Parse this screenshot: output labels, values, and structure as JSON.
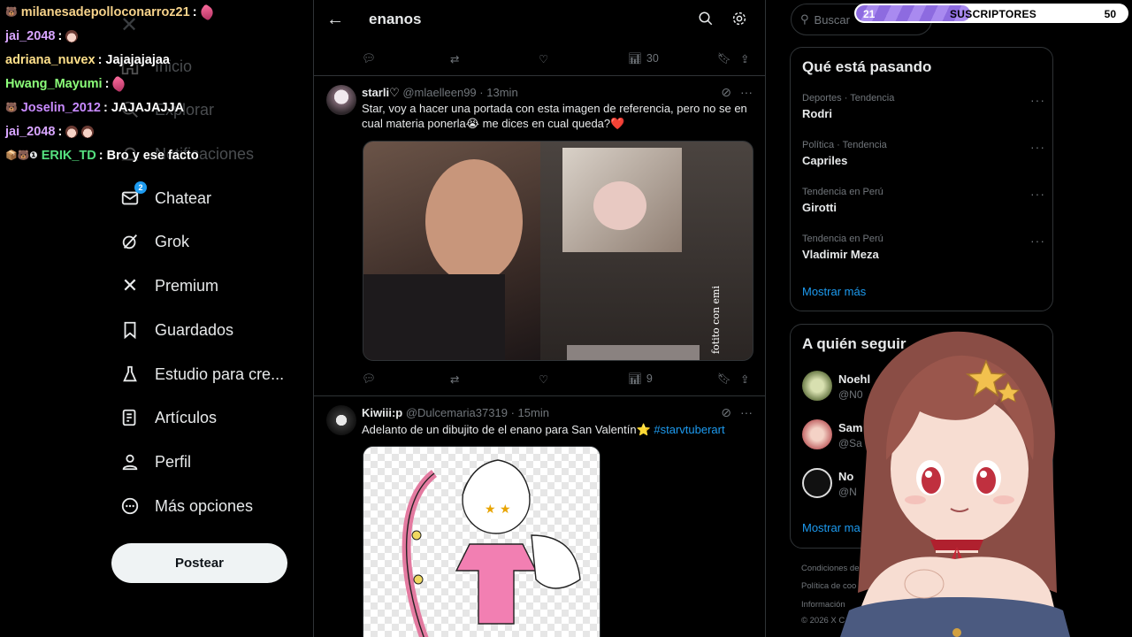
{
  "chat": [
    {
      "user": "milanesadepolloconarroz21",
      "color": "#f7d38b",
      "msg": "",
      "badge": "🐻",
      "emotes": [
        "rocket"
      ]
    },
    {
      "user": "jai_2048",
      "color": "#d8a5ff",
      "msg": "",
      "badge": "",
      "emotes": [
        "face"
      ]
    },
    {
      "user": "adriana_nuvex",
      "color": "#ffe08a",
      "msg": "Jajajajajaa",
      "badge": "",
      "emotes": []
    },
    {
      "user": "Hwang_Mayumi",
      "color": "#8cff7a",
      "msg": "",
      "badge": "",
      "emotes": [
        "rocket"
      ]
    },
    {
      "user": "Joselin_2012",
      "color": "#c98bff",
      "msg": "JAJAJAJJA",
      "badge": "🐻",
      "emotes": []
    },
    {
      "user": "jai_2048",
      "color": "#d8a5ff",
      "msg": "",
      "badge": "",
      "emotes": [
        "face",
        "face"
      ]
    },
    {
      "user": "ERIK_TD",
      "color": "#55e07f",
      "msg": "Bro y ese facto",
      "badge": "📦🐻❶",
      "emotes": []
    }
  ],
  "nav": {
    "items": [
      {
        "label": "Inicio",
        "icon": "home-icon",
        "faded": true
      },
      {
        "label": "Explorar",
        "icon": "search-icon",
        "faded": true
      },
      {
        "label": "Notificaciones",
        "icon": "bell-icon",
        "faded": true
      },
      {
        "label": "Chatear",
        "icon": "mail-icon",
        "faded": false,
        "badge": "2"
      },
      {
        "label": "Grok",
        "icon": "grok-icon",
        "faded": false
      },
      {
        "label": "Premium",
        "icon": "x-icon",
        "faded": false
      },
      {
        "label": "Guardados",
        "icon": "bookmark-icon",
        "faded": false
      },
      {
        "label": "Estudio para cre...",
        "icon": "flask-icon",
        "faded": false
      },
      {
        "label": "Artículos",
        "icon": "article-icon",
        "faded": false
      },
      {
        "label": "Perfil",
        "icon": "person-icon",
        "faded": false
      },
      {
        "label": "Más opciones",
        "icon": "more-circle-icon",
        "faded": false
      }
    ],
    "post_label": "Postear"
  },
  "feed": {
    "search_term": "enanos",
    "top_actions": {
      "views": "30"
    },
    "tweets": [
      {
        "name": "starli♡",
        "handle": "@mlaelleen99",
        "time": "13min",
        "text": "Star, voy a hacer una portada con esta imagen de referencia, pero no se en cual materia ponerla😭 me dices en cual queda?❤️",
        "image_text": "fotito con emi",
        "views": "9"
      },
      {
        "name": "Kiwiii:p",
        "handle": "@Dulcemaria37319",
        "time": "15min",
        "text": "Adelanto de un dibujito de el enano para San Valentín⭐",
        "hashtag": "#starvtuberart"
      }
    ]
  },
  "right": {
    "search_placeholder": "Buscar",
    "trends_title": "Qué está pasando",
    "trends": [
      {
        "context": "Deportes · Tendencia",
        "name": "Rodri"
      },
      {
        "context": "Política · Tendencia",
        "name": "Capriles"
      },
      {
        "context": "Tendencia en Perú",
        "name": "Girotti"
      },
      {
        "context": "Tendencia en Perú",
        "name": "Vladimir Meza"
      }
    ],
    "show_more": "Mostrar más",
    "follow_title": "A quién seguir",
    "follow": [
      {
        "name": "Noehl",
        "handle": "@N0"
      },
      {
        "name": "Sam",
        "handle": "@Sa"
      },
      {
        "name": "No",
        "handle": "@N"
      }
    ],
    "follow_show_more": "Mostrar ma",
    "footer": [
      "Condiciones de S",
      "Política de coo",
      "Información",
      "© 2026 X C"
    ]
  },
  "subs": {
    "current": "21",
    "label": "SUSCRIPTORES",
    "goal": "50",
    "progress": 0.42
  }
}
